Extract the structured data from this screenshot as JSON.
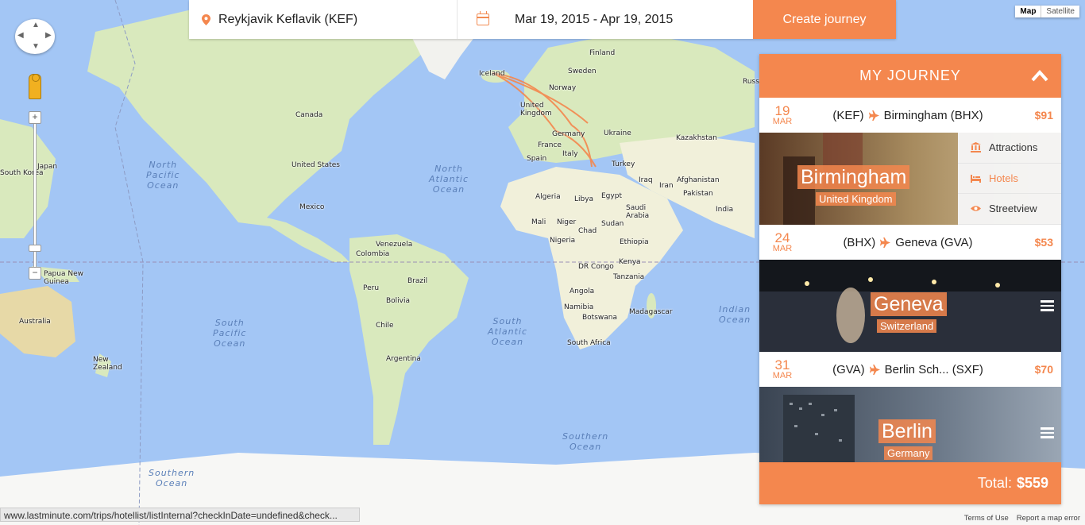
{
  "search": {
    "origin": "Reykjavik Keflavik (KEF)",
    "dates": "Mar 19, 2015 - Apr 19, 2015",
    "create_label": "Create journey"
  },
  "map": {
    "type_buttons": [
      "Map",
      "Satellite"
    ],
    "status_url": "www.lastminute.com/trips/hotellist/listInternal?checkInDate=undefined&check...",
    "terms": "Terms of Use",
    "report": "Report a map error",
    "labels": {
      "iceland": "Iceland",
      "finland": "Finland",
      "sweden": "Sweden",
      "norway": "Norway",
      "russia": "Russ",
      "uk": "United Kingdom",
      "germany": "Germany",
      "ukraine": "Ukraine",
      "france": "France",
      "italy": "Italy",
      "spain": "Spain",
      "turkey": "Turkey",
      "kazakhstan": "Kazakhstan",
      "afghanistan": "Afghanistan",
      "iraq": "Iraq",
      "iran": "Iran",
      "pakistan": "Pakistan",
      "india": "India",
      "egypt": "Egypt",
      "libya": "Libya",
      "algeria": "Algeria",
      "saudi": "Saudi Arabia",
      "mali": "Mali",
      "niger": "Niger",
      "chad": "Chad",
      "sudan": "Sudan",
      "nigeria": "Nigeria",
      "ethiopia": "Ethiopia",
      "kenya": "Kenya",
      "drc": "DR Congo",
      "tanzania": "Tanzania",
      "angola": "Angola",
      "namibia": "Namibia",
      "botswana": "Botswana",
      "madagascar": "Madagascar",
      "southafrica": "South Africa",
      "canada": "Canada",
      "usa": "United States",
      "mexico": "Mexico",
      "venezuela": "Venezuela",
      "colombia": "Colombia",
      "peru": "Peru",
      "brazil": "Brazil",
      "bolivia": "Bolivia",
      "chile": "Chile",
      "argentina": "Argentina",
      "japan": "Japan",
      "southkorea": "South Korea",
      "png": "Papua New Guinea",
      "australia": "Australia",
      "nz": "New Zealand"
    },
    "oceans": {
      "north_pacific": "North\nPacific\nOcean",
      "north_atlantic": "North\nAtlantic\nOcean",
      "south_pacific": "South\nPacific\nOcean",
      "south_atlantic": "South\nAtlantic\nOcean",
      "indian": "Indian\nOcean",
      "southern": "Southern\nOcean"
    }
  },
  "journey": {
    "title": "MY JOURNEY",
    "legs": [
      {
        "day": "19",
        "month": "MAR",
        "from": "(KEF)",
        "to": "Birmingham (BHX)",
        "price": "$91"
      },
      {
        "day": "24",
        "month": "MAR",
        "from": "(BHX)",
        "to": "Geneva (GVA)",
        "price": "$53"
      },
      {
        "day": "31",
        "month": "MAR",
        "from": "(GVA)",
        "to": "Berlin Sch... (SXF)",
        "price": "$70"
      }
    ],
    "cities": [
      {
        "name": "Birmingham",
        "country": "United Kingdom"
      },
      {
        "name": "Geneva",
        "country": "Switzerland"
      },
      {
        "name": "Berlin",
        "country": "Germany"
      }
    ],
    "menu": {
      "attractions": "Attractions",
      "hotels": "Hotels",
      "streetview": "Streetview"
    },
    "total_label": "Total:",
    "total_value": "$559"
  },
  "colors": {
    "accent": "#f4874e",
    "water": "#a3c6f5",
    "land": "#d9e9bd"
  }
}
